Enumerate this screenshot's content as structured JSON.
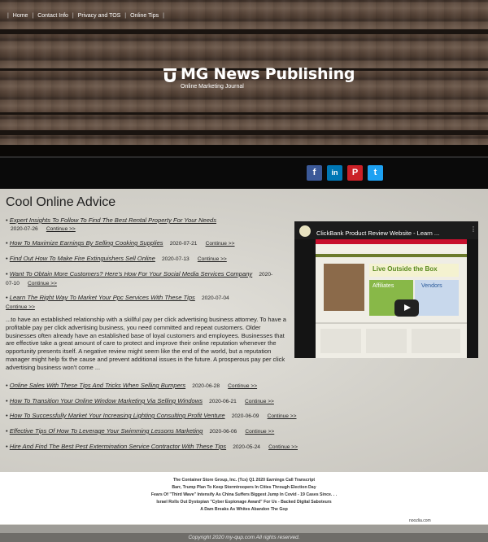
{
  "header": {
    "site_title": "MG News Publishing",
    "tagline": "Online Marketing Journal"
  },
  "nav": {
    "items": [
      {
        "label": "Home"
      },
      {
        "label": "Contact Info"
      },
      {
        "label": "Privacy and TOS"
      },
      {
        "label": "Online Tips"
      }
    ],
    "social": [
      {
        "icon": "facebook-icon",
        "glyph": "f",
        "color": "#3b5998"
      },
      {
        "icon": "linkedin-icon",
        "glyph": "in",
        "color": "#0077b5"
      },
      {
        "icon": "pinterest-icon",
        "glyph": "P",
        "color": "#cb2027"
      },
      {
        "icon": "twitter-icon",
        "glyph": "t",
        "color": "#1da1f2"
      }
    ]
  },
  "main": {
    "title": "Cool Online Advice",
    "continue_label": "Continue >>",
    "posts_top": [
      {
        "title": "Expert Insights To Follow To Find The Best Rental Property For Your Needs",
        "date": "2020-07-26"
      },
      {
        "title": "How To Maximize Earnings By Selling Cooking Supplies",
        "date": "2020-07-21"
      },
      {
        "title": "Find Out How To Make Fire Extinguishers Sell Online",
        "date": "2020-07-13"
      },
      {
        "title": "Want To Obtain More Customers? Here's How For Your Social Media Services Company",
        "date": "2020-07-10"
      },
      {
        "title": "Learn The Right Way To Market Your Ppc Services With These Tips",
        "date": "2020-07-04"
      }
    ],
    "excerpt": "...to have an established relationship with a skillful pay per click advertising business attorney. To have a profitable pay per click advertising business, you need committed and repeat customers. Older businesses often already have an established base of loyal customers and employees. Businesses that are effective take a great amount of care to protect and improve their online reputation whenever the opportunity presents itself. A negative review might seem like the end of the world, but a reputation manager might help fix the cause and prevent additional issues in the future. A prosperous pay per click advertising business won't come ...",
    "posts_bottom": [
      {
        "title": "Online Sales With These Tips And Tricks When Selling Bumpers",
        "date": "2020-06-28"
      },
      {
        "title": "How To Transition Your Online Window Marketing Via Selling Windows",
        "date": "2020-06-21"
      },
      {
        "title": "How To Successfully Market Your Increasing Lighting Consulting Profit Venture",
        "date": "2020-06-09"
      },
      {
        "title": "Effective Tips Of How To Leverage Your Swimming Lessons Marketing",
        "date": "2020-06-06"
      },
      {
        "title": "Hire And Find The Best Pest Extermination Service Contractor With These Tips",
        "date": "2020-05-24"
      }
    ]
  },
  "video": {
    "title": "ClickBank Product Review Website - Learn ...",
    "screen_banner": "Live Outside the Box",
    "screen_left": "Affiliates",
    "screen_right": "Vendors"
  },
  "related": {
    "items": [
      "The Container Store Group, Inc. (Tcs) Q1 2020 Earnings Call Transcript",
      "Barr, Trump Plan To Keep Stormtroopers In Cities Through Election Day",
      "Fears Of \"Third Wave\" Intensify As China Suffers Biggest Jump In Covid - 19 Cases Since. . .",
      "Israel Rolls Out Dystopian \"Cyber Espionage Award\" For Us - Backed Digital Saboteurs",
      "A Dam Breaks As Whites Abandon The Gop"
    ],
    "credit": "noozlia.com"
  },
  "footer": {
    "copyright": "Copyright 2020 my-qup.com All rights reserved."
  }
}
